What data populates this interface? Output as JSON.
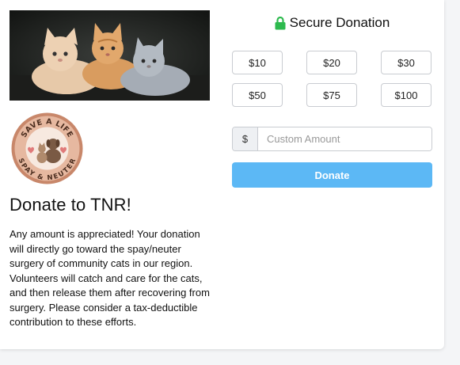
{
  "header": {
    "secure_label": "Secure Donation",
    "lock_icon": "lock-icon",
    "lock_color": "#2dba4e"
  },
  "campaign": {
    "title": "Donate to TNR!",
    "description": "Any amount is appreciated! Your donation will directly go toward the spay/neuter surgery of community cats in our region. Volunteers will catch and care for the cats, and then release them after recovering from surgery. Please consider a tax-deductible contribution to these efforts.",
    "hero_image": "kittens-photo",
    "logo": {
      "image": "spay-neuter-logo",
      "text_top": "SAVE A LIFE",
      "text_bottom": "SPAY & NEUTER"
    }
  },
  "amounts": [
    {
      "label": "$10"
    },
    {
      "label": "$20"
    },
    {
      "label": "$30"
    },
    {
      "label": "$50"
    },
    {
      "label": "$75"
    },
    {
      "label": "$100"
    }
  ],
  "custom": {
    "currency": "$",
    "placeholder": "Custom Amount",
    "value": ""
  },
  "donate_label": "Donate",
  "colors": {
    "accent": "#5cb8f5",
    "lock": "#2dba4e"
  }
}
